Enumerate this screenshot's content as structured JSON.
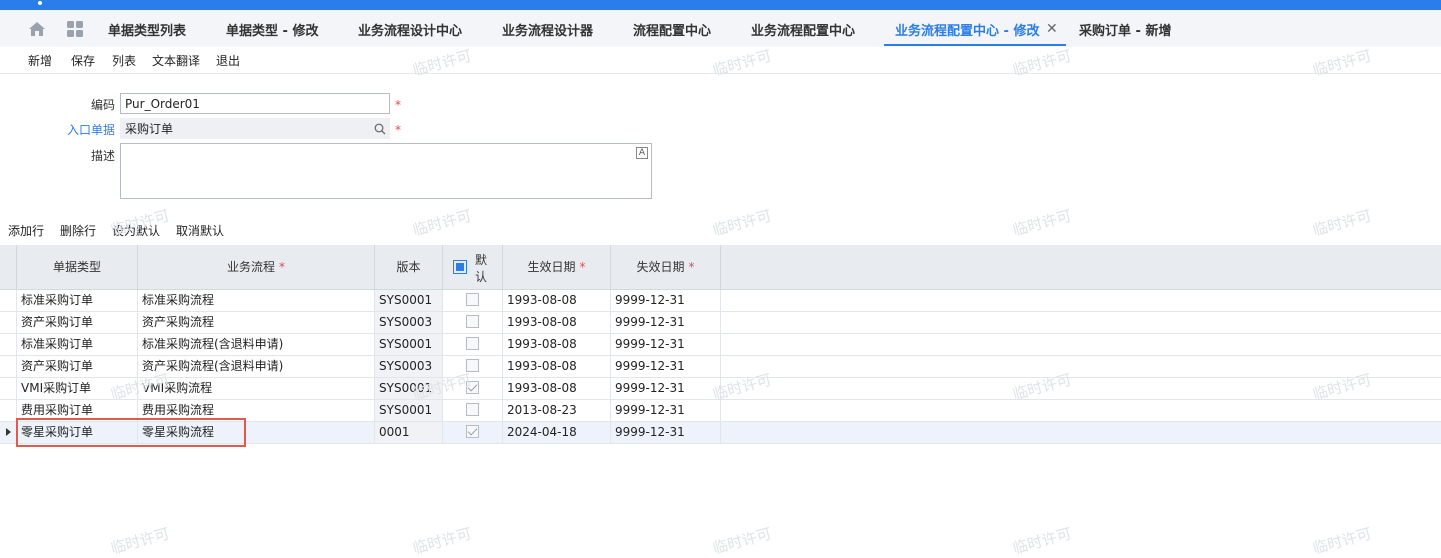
{
  "tabs": [
    {
      "label": "单据类型列表"
    },
    {
      "label": "单据类型 - 修改"
    },
    {
      "label": "业务流程设计中心"
    },
    {
      "label": "业务流程设计器"
    },
    {
      "label": "流程配置中心"
    },
    {
      "label": "业务流程配置中心"
    },
    {
      "label": "业务流程配置中心 - 修改",
      "active": true
    },
    {
      "label": "采购订单 - 新增"
    }
  ],
  "tab_close": "✕",
  "toolbar": {
    "new": "新增",
    "save": "保存",
    "list": "列表",
    "translate": "文本翻译",
    "exit": "退出"
  },
  "form": {
    "code_label": "编码",
    "code_value": "Pur_Order01",
    "entry_label": "入口单据",
    "entry_value": "采购订单",
    "desc_label": "描述",
    "required_mark": "*"
  },
  "grid_toolbar": {
    "add_row": "添加行",
    "delete_row": "删除行",
    "set_default": "设为默认",
    "cancel_default": "取消默认"
  },
  "grid": {
    "headers": {
      "bill_type": "单据类型",
      "process": "业务流程",
      "version": "版本",
      "default_1": "默",
      "default_2": "认",
      "start_date": "生效日期",
      "end_date": "失效日期"
    },
    "rows": [
      {
        "bill_type": "标准采购订单",
        "process": "标准采购流程",
        "version": "SYS0001",
        "default": false,
        "start": "1993-08-08",
        "end": "9999-12-31"
      },
      {
        "bill_type": "资产采购订单",
        "process": "资产采购流程",
        "version": "SYS0003",
        "default": false,
        "start": "1993-08-08",
        "end": "9999-12-31"
      },
      {
        "bill_type": "标准采购订单",
        "process": "标准采购流程(含退料申请)",
        "version": "SYS0001",
        "default": false,
        "start": "1993-08-08",
        "end": "9999-12-31"
      },
      {
        "bill_type": "资产采购订单",
        "process": "资产采购流程(含退料申请)",
        "version": "SYS0003",
        "default": false,
        "start": "1993-08-08",
        "end": "9999-12-31"
      },
      {
        "bill_type": "VMI采购订单",
        "process": "VMI采购流程",
        "version": "SYS0001",
        "default": true,
        "start": "1993-08-08",
        "end": "9999-12-31"
      },
      {
        "bill_type": "费用采购订单",
        "process": "费用采购流程",
        "version": "SYS0001",
        "default": false,
        "start": "2013-08-23",
        "end": "9999-12-31"
      },
      {
        "bill_type": "零星采购订单",
        "process": "零星采购流程",
        "version": "0001",
        "default": true,
        "start": "2024-04-18",
        "end": "9999-12-31",
        "selected": true
      }
    ]
  },
  "watermark": "临时许可",
  "colors": {
    "accent": "#2b7de9",
    "required": "#e34a4a",
    "highlight": "#e05a4e"
  }
}
